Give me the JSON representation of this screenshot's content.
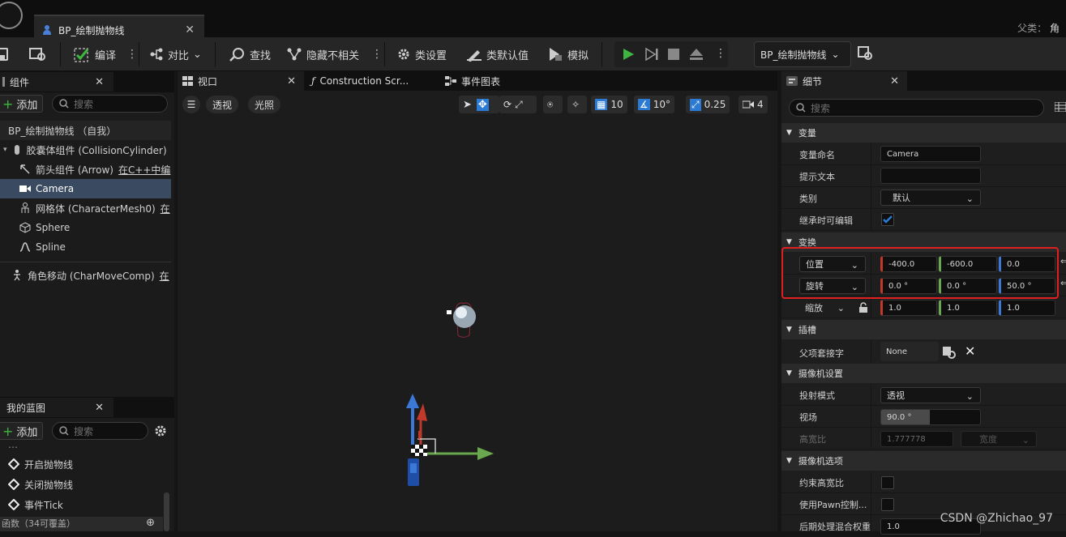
{
  "window": {
    "tab_title": "BP_绘制抛物线",
    "parent_class_label": "父类：",
    "parent_class_value": "角"
  },
  "toolbar": {
    "compile": "编译",
    "diff": "对比",
    "find": "查找",
    "hide_unrelated": "隐藏不相关",
    "class_settings": "类设置",
    "class_defaults": "类默认值",
    "simulate": "模拟",
    "blueprint_select": "BP_绘制抛物线"
  },
  "components": {
    "tab": "组件",
    "add": "添加",
    "search_placeholder": "搜索",
    "items": [
      {
        "label": "BP_绘制抛物线 （自我）"
      },
      {
        "label": "胶囊体组件 (CollisionCylinder)"
      },
      {
        "label": "箭头组件 (Arrow)",
        "suffix": "在C++中编"
      },
      {
        "label": "Camera"
      },
      {
        "label": "网格体 (CharacterMesh0)",
        "suffix": "在"
      },
      {
        "label": "Sphere"
      },
      {
        "label": "Spline"
      },
      {
        "label": "角色移动 (CharMoveComp)",
        "suffix": "在"
      }
    ]
  },
  "my_blueprint": {
    "tab": "我的蓝图",
    "add": "添加",
    "search_placeholder": "搜索",
    "cut_top": "…",
    "items": [
      "开启抛物线",
      "关闭抛物线",
      "事件Tick"
    ],
    "functions_header": "函数（34可覆盖）"
  },
  "editor_tabs": {
    "viewport": "视口",
    "construction": "Construction Scr...",
    "event_graph": "事件图表"
  },
  "viewport": {
    "perspective": "透视",
    "lit": "光照",
    "grid_snap": "10",
    "rotation_snap": "10°",
    "scale_snap": "0.25",
    "camera_speed": "4"
  },
  "details": {
    "tab": "细节",
    "search_placeholder": "搜索",
    "categories": {
      "variable": "变量",
      "transform": "变换",
      "sockets": "插槽",
      "camera_settings": "摄像机设置",
      "camera_options": "摄像机选项"
    },
    "variable_name_label": "变量命名",
    "variable_name": "Camera",
    "tooltip_label": "提示文本",
    "tooltip": "",
    "category_label": "类别",
    "category": "默认",
    "editable_label": "继承时可编辑",
    "location_label": "位置",
    "location": [
      "-400.0",
      "-600.0",
      "0.0"
    ],
    "rotation_label": "旋转",
    "rotation": [
      "0.0 °",
      "0.0 °",
      "50.0 °"
    ],
    "scale_label": "缩放",
    "scale": [
      "1.0",
      "1.0",
      "1.0"
    ],
    "parent_socket_label": "父项套接字",
    "parent_socket": "None",
    "projection_label": "投射模式",
    "projection": "透视",
    "fov_label": "视场",
    "fov": "90.0 °",
    "aspect_label": "高宽比",
    "aspect": "1.777778",
    "aspect_preset": "宽度",
    "constrain_label": "约束高宽比",
    "use_pawn_label": "使用Pawn控制...",
    "pp_weight_label": "后期处理混合权重",
    "pp_weight": "1.0"
  },
  "watermark": "CSDN @Zhichao_97",
  "colors": {
    "x_axis": "#c0392b",
    "y_axis": "#6aa84f",
    "z_axis": "#3c78d8",
    "highlight": "#e02020",
    "play": "#3fb63f",
    "accent": "#2b7bd5"
  }
}
